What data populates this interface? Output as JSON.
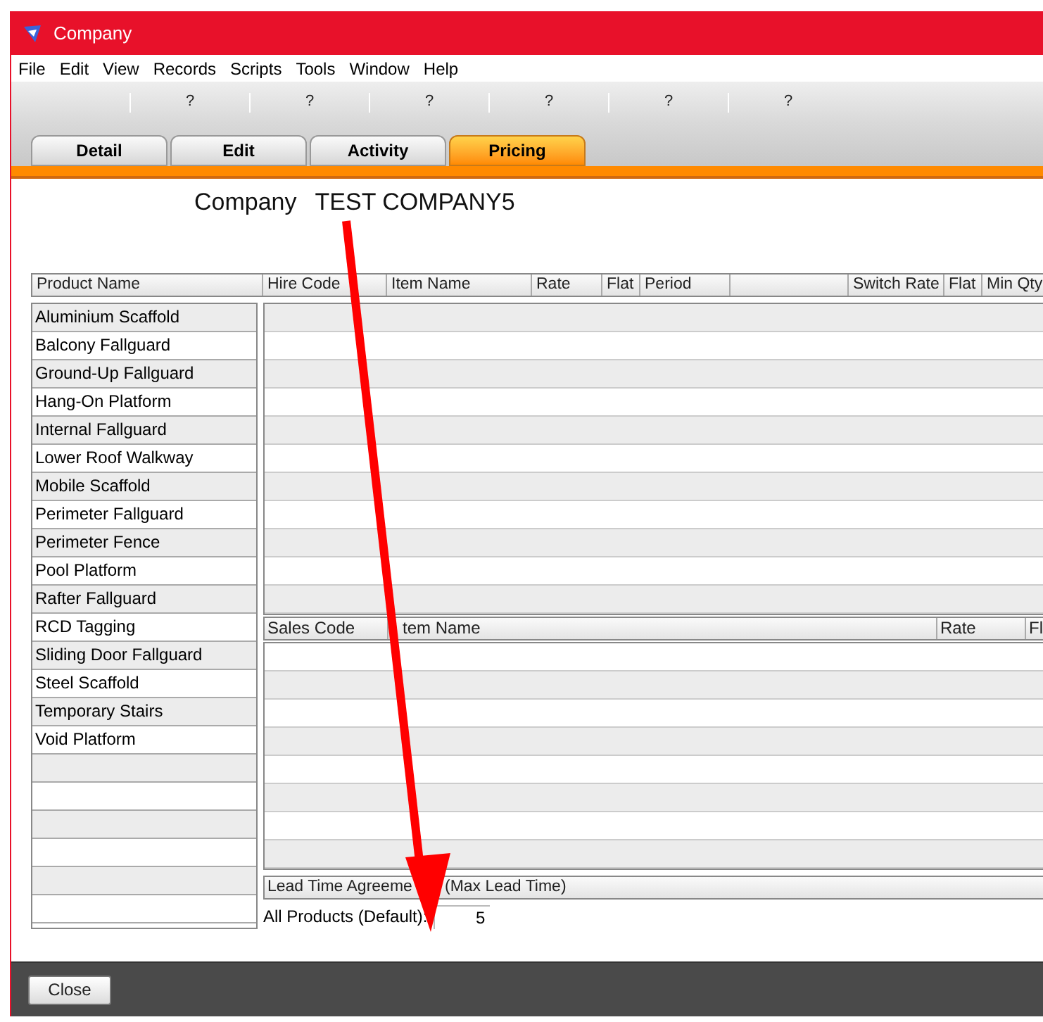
{
  "window": {
    "title": "Company"
  },
  "menu": [
    "File",
    "Edit",
    "View",
    "Records",
    "Scripts",
    "Tools",
    "Window",
    "Help"
  ],
  "toolbar": [
    "?",
    "?",
    "?",
    "?",
    "?",
    "?"
  ],
  "tabs": [
    {
      "label": "Detail",
      "selected": false
    },
    {
      "label": "Edit",
      "selected": false
    },
    {
      "label": "Activity",
      "selected": false
    },
    {
      "label": "Pricing",
      "selected": true
    }
  ],
  "heading": {
    "label": "Company",
    "value": "TEST COMPANY5"
  },
  "hire_columns": [
    "Product Name",
    "Hire Code",
    "Item Name",
    "Rate",
    "Flat",
    "Period",
    "Switch Rate",
    "Flat",
    "Min Qty"
  ],
  "products": [
    "Aluminium Scaffold",
    "Balcony Fallguard",
    "Ground-Up Fallguard",
    "Hang-On Platform",
    "Internal Fallguard",
    "Lower Roof Walkway",
    "Mobile Scaffold",
    "Perimeter Fallguard",
    "Perimeter Fence",
    "Pool Platform",
    "Rafter Fallguard",
    "RCD Tagging",
    "Sliding Door Fallguard",
    "Steel Scaffold",
    "Temporary Stairs",
    "Void Platform"
  ],
  "sales_columns": [
    "Sales Code",
    "tem Name",
    "Rate",
    "Fl"
  ],
  "lead_time": {
    "header": [
      "Lead Time Agreeme",
      "(Max Lead Time)"
    ],
    "label": "All Products (Default):",
    "value": "5"
  },
  "buttons": [
    "Close"
  ]
}
